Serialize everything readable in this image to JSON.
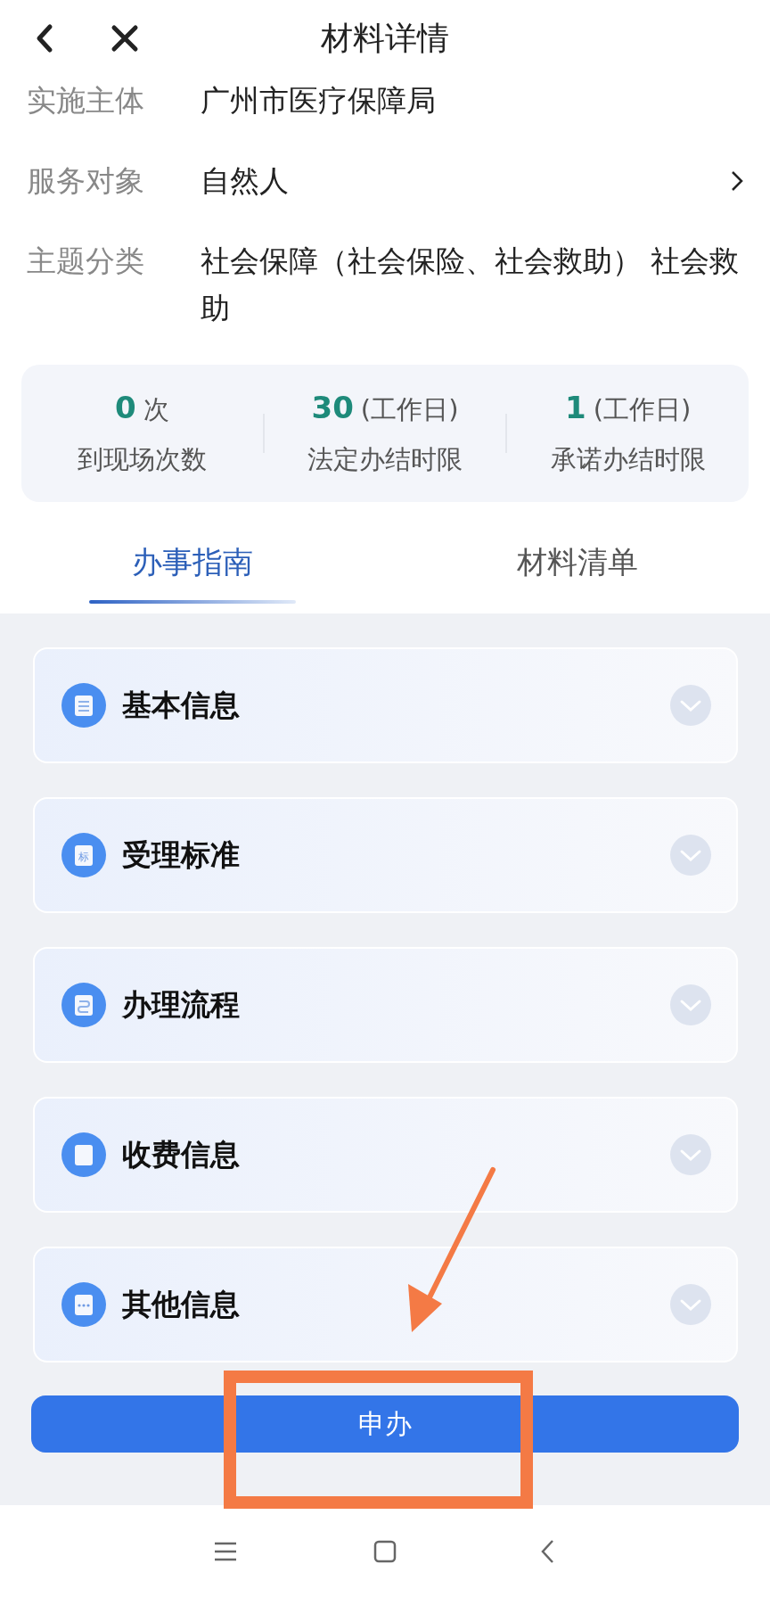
{
  "header": {
    "title": "材料详情"
  },
  "info_rows": [
    {
      "label": "实施主体",
      "value": "广州市医疗保障局",
      "has_arrow": false
    },
    {
      "label": "服务对象",
      "value": "自然人",
      "has_arrow": true
    },
    {
      "label": "主题分类",
      "value": "社会保障（社会保险、社会救助） 社会救助",
      "has_arrow": false
    }
  ],
  "stats": [
    {
      "value": "0",
      "unit": "次",
      "label": "到现场次数"
    },
    {
      "value": "30",
      "unit": "(工作日)",
      "label": "法定办结时限"
    },
    {
      "value": "1",
      "unit": "(工作日)",
      "label": "承诺办结时限"
    }
  ],
  "tabs": [
    {
      "label": "办事指南",
      "selected": true
    },
    {
      "label": "材料清单",
      "selected": false
    }
  ],
  "sections": [
    {
      "title": "基本信息",
      "kind": "lines",
      "expanded": false
    },
    {
      "title": "受理标准",
      "kind": "char",
      "icon_char": "标",
      "expanded": false
    },
    {
      "title": "办理流程",
      "kind": "flow",
      "expanded": false
    },
    {
      "title": "收费信息",
      "kind": "blank",
      "expanded": false
    },
    {
      "title": "其他信息",
      "kind": "dots",
      "expanded": false
    }
  ],
  "apply_button": {
    "label": "申办"
  }
}
